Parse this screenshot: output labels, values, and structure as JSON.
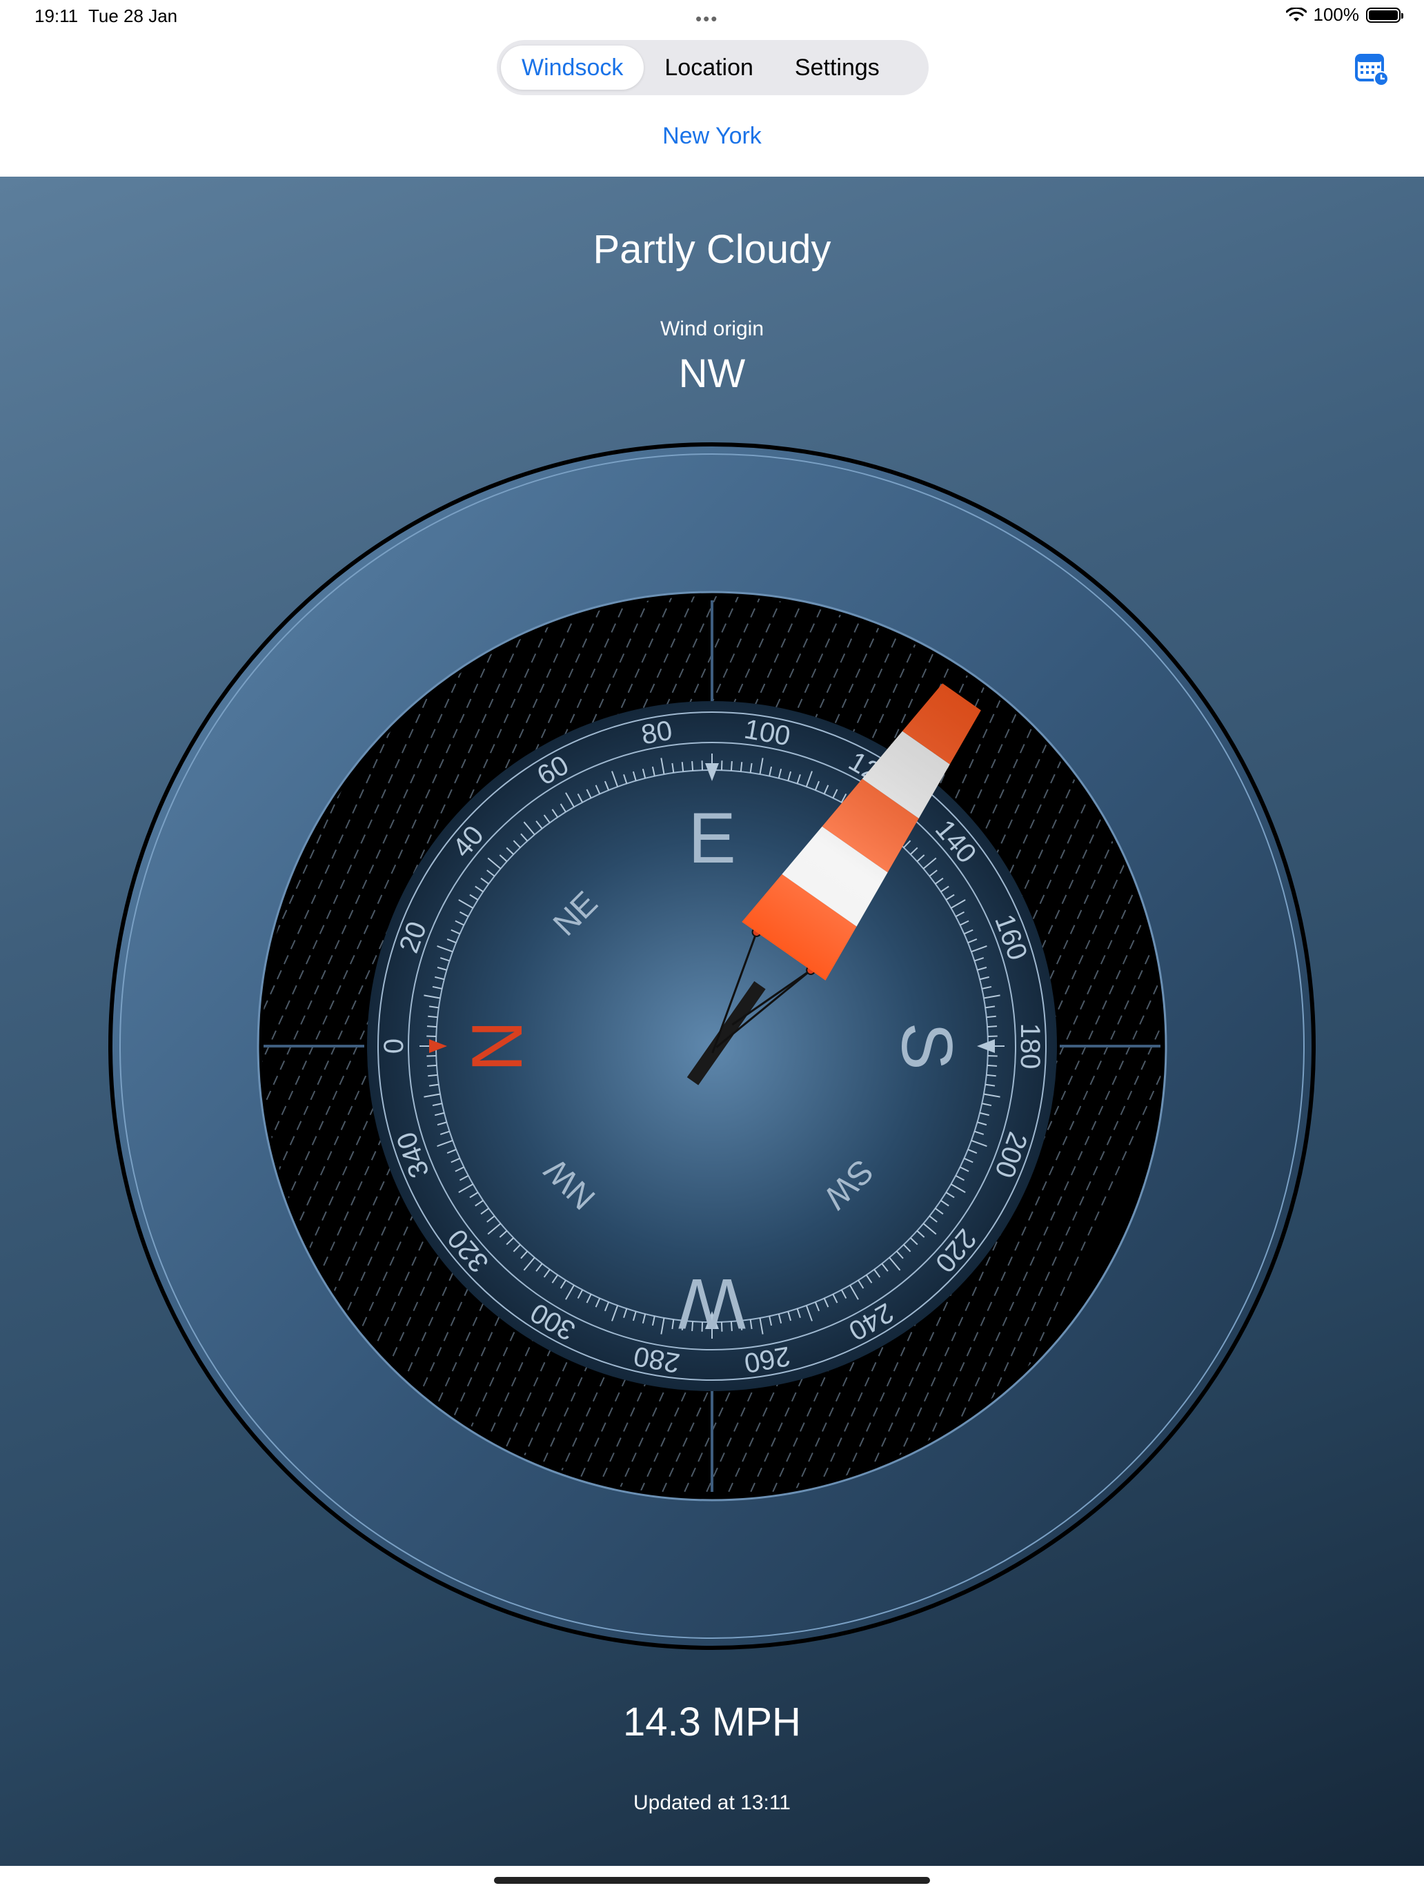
{
  "status_bar": {
    "time": "19:11",
    "date": "Tue 28 Jan",
    "battery": "100%",
    "battery_level": 1.0
  },
  "tabs": [
    {
      "label": "Windsock",
      "active": true
    },
    {
      "label": "Location",
      "active": false
    },
    {
      "label": "Settings",
      "active": false
    }
  ],
  "calendar_icon": "calendar-clock-icon",
  "location": "New York",
  "weather": {
    "condition": "Partly Cloudy",
    "wind_origin_label": "Wind origin",
    "wind_origin": "NW",
    "speed": "14.3 MPH",
    "updated": "Updated at 13:11"
  },
  "compass": {
    "cardinals": {
      "north": "N",
      "east": "E",
      "south": "S",
      "west": "W"
    },
    "intercardinals": {
      "ne": "NE",
      "nw": "NW",
      "sw": "SW"
    },
    "degree_labels": [
      "0",
      "20",
      "40",
      "60",
      "80",
      "100",
      "120",
      "140",
      "160",
      "180",
      "200",
      "220",
      "240",
      "260",
      "280",
      "300",
      "320",
      "340"
    ]
  },
  "colors": {
    "accent": "#1a73e8",
    "panel_top": "#5c7e9c",
    "panel_bottom": "#16283a",
    "north_marker": "#d9401f",
    "sock_orange": "#ff5a1f",
    "sock_white": "#ffffff"
  }
}
